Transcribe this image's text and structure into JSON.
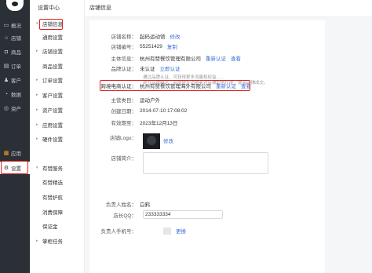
{
  "nav": {
    "items": [
      {
        "label": "概况",
        "icon": "monitor-icon"
      },
      {
        "label": "店铺",
        "icon": "store-icon"
      },
      {
        "label": "商品",
        "icon": "bag-icon"
      },
      {
        "label": "订单",
        "icon": "order-icon"
      },
      {
        "label": "客户",
        "icon": "user-icon"
      },
      {
        "label": "数据",
        "icon": "data-icon"
      },
      {
        "label": "资产",
        "icon": "asset-icon"
      },
      {
        "label": "应用",
        "icon": "apps-icon"
      },
      {
        "label": "设置",
        "icon": "gear-icon"
      }
    ]
  },
  "submenu": {
    "head": "设置中心",
    "items": [
      {
        "label": "店铺信息",
        "expand": "▾"
      },
      {
        "label": "通用设置"
      },
      {
        "label": "店铺设置",
        "expand": "▸"
      },
      {
        "label": "商品设置"
      },
      {
        "label": "订单设置",
        "expand": "▸"
      },
      {
        "label": "客户设置",
        "expand": "▸"
      },
      {
        "label": "资产设置",
        "expand": "▸"
      },
      {
        "label": "应用设置",
        "expand": "▸"
      },
      {
        "label": "硬件设置",
        "expand": "▸"
      },
      {
        "label": "有赞服务",
        "expand": "▾"
      },
      {
        "label": "有赞精选"
      },
      {
        "label": "有赞护航"
      },
      {
        "label": "消费保障"
      },
      {
        "label": "保证金"
      },
      {
        "label": "掌柜任务",
        "expand": "▸"
      }
    ]
  },
  "page": {
    "title": "店铺信息",
    "rows": {
      "shop_name": {
        "label": "店铺名称：",
        "value": "起码运动馆",
        "link": "修改"
      },
      "shop_no": {
        "label": "店铺编号：",
        "value": "55251429",
        "link": "复制"
      },
      "main_info": {
        "label": "主体信息：",
        "value": "杭州有赞餐饮管理有限公司",
        "link": "重新认证",
        "link2": "查看"
      },
      "brand_cert": {
        "label": "品牌认证：",
        "value": "未认证",
        "link": "立即认证"
      },
      "cross_border": {
        "label": "跨境电商认证：",
        "value": "杭州有赞餐饮管理海外有限公司",
        "link": "重新认证",
        "link2": "查看"
      },
      "category": {
        "label": "主营类目：",
        "value": "运动户外"
      },
      "created": {
        "label": "创建日期：",
        "value": "2014-07-10 17:08:02"
      },
      "valid": {
        "label": "有效期至：",
        "value": "2023年12月13日"
      },
      "logo": {
        "label": "店铺Logo：",
        "link": "修改"
      },
      "intro": {
        "label": "店铺简介："
      },
      "owner": {
        "label": "负责人姓名：",
        "value": "白鸦"
      },
      "qq": {
        "label": "店长QQ：",
        "value": "233333334"
      },
      "phone": {
        "label": "负责人手机号：",
        "link": "更换"
      }
    },
    "hints": {
      "brand": "通过品牌认证，可获得更多流量和权益……",
      "brand2": "提升品牌曝光，有助提升消费者对店铺的信任度，提高店铺成交。"
    }
  },
  "colors": {
    "nav_bg": "#2b2f36",
    "link": "#3a6fd8",
    "highlight": "#e02020"
  }
}
